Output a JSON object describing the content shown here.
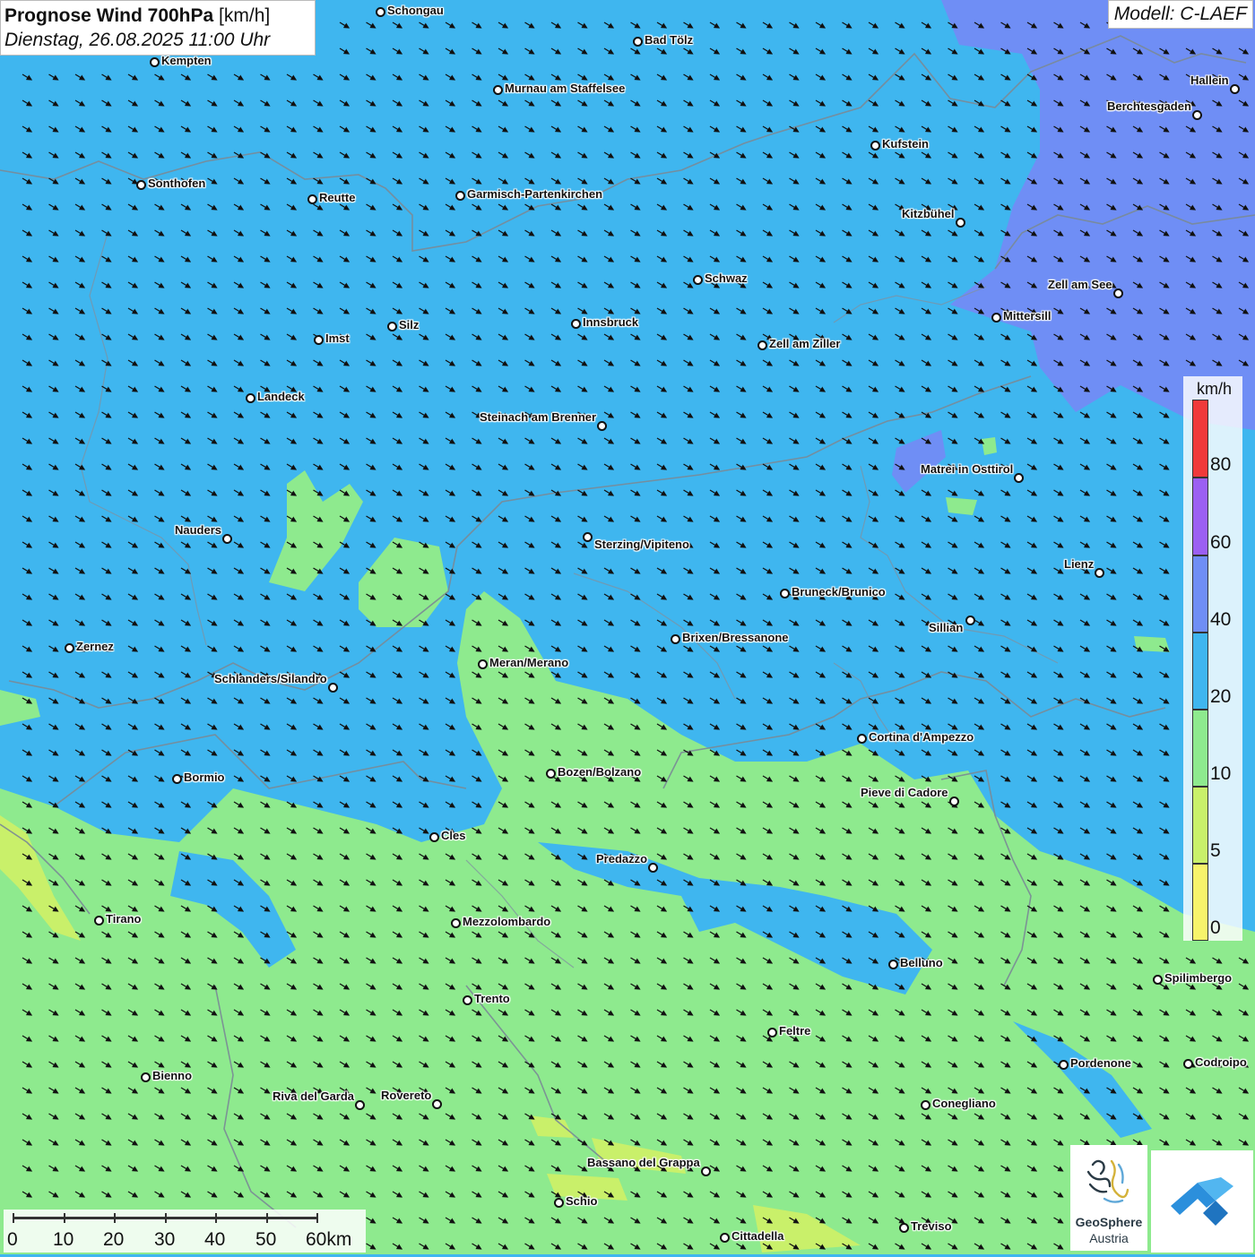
{
  "header": {
    "title_bold": "Prognose Wind 700hPa",
    "title_unit": "[km/h]",
    "datetime": "Dienstag, 26.08.2025 11:00 Uhr",
    "model": "Modell: C-LAEF"
  },
  "legend": {
    "unit": "km/h",
    "labels": [
      "80",
      "60",
      "40",
      "20",
      "10",
      "5",
      "0"
    ],
    "colors": {
      "80": "#f03a3a",
      "60": "#9b5ff2",
      "40": "#6f8ef5",
      "20": "#3fb6ef",
      "10": "#8eea8e",
      "5": "#c9f06a",
      "0": "#f7f36b"
    }
  },
  "scale_bar": {
    "labels": [
      "0",
      "10",
      "20",
      "30",
      "40",
      "50",
      "60km"
    ]
  },
  "logos": {
    "geosphere_line1": "GeoSphere",
    "geosphere_line2": "Austria"
  },
  "cities": [
    {
      "name": "Schongau"
    },
    {
      "name": "Bad Tölz"
    },
    {
      "name": "Kempten"
    },
    {
      "name": "Murnau am Staffelsee"
    },
    {
      "name": "Hallein"
    },
    {
      "name": "Berchtesgaden"
    },
    {
      "name": "Kufstein"
    },
    {
      "name": "Sonthofen"
    },
    {
      "name": "Reutte"
    },
    {
      "name": "Garmisch-Partenkirchen"
    },
    {
      "name": "Kitzbühel"
    },
    {
      "name": "Schwaz"
    },
    {
      "name": "Zell am See"
    },
    {
      "name": "Mittersill"
    },
    {
      "name": "Silz"
    },
    {
      "name": "Innsbruck"
    },
    {
      "name": "Imst"
    },
    {
      "name": "Zell am Ziller"
    },
    {
      "name": "Landeck"
    },
    {
      "name": "Steinach am Brenner"
    },
    {
      "name": "Matrei in Osttirol"
    },
    {
      "name": "Nauders"
    },
    {
      "name": "Sterzing/Vipiteno"
    },
    {
      "name": "Lienz"
    },
    {
      "name": "Bruneck/Brunico"
    },
    {
      "name": "Sillian"
    },
    {
      "name": "Zernez"
    },
    {
      "name": "Brixen/Bressanone"
    },
    {
      "name": "Meran/Merano"
    },
    {
      "name": "Schlanders/Silandro"
    },
    {
      "name": "Cortina d'Ampezzo"
    },
    {
      "name": "Bozen/Bolzano"
    },
    {
      "name": "Bormio"
    },
    {
      "name": "Pieve di Cadore"
    },
    {
      "name": "Cles"
    },
    {
      "name": "Predazzo"
    },
    {
      "name": "Tirano"
    },
    {
      "name": "Mezzolombardo"
    },
    {
      "name": "Belluno"
    },
    {
      "name": "Spilimbergo"
    },
    {
      "name": "Trento"
    },
    {
      "name": "Feltre"
    },
    {
      "name": "Pordenone"
    },
    {
      "name": "Codroipo"
    },
    {
      "name": "Bienno"
    },
    {
      "name": "Riva del Garda"
    },
    {
      "name": "Rovereto"
    },
    {
      "name": "Conegliano"
    },
    {
      "name": "Bassano del Grappa"
    },
    {
      "name": "Schio"
    },
    {
      "name": "Treviso"
    },
    {
      "name": "Cittadella"
    }
  ]
}
